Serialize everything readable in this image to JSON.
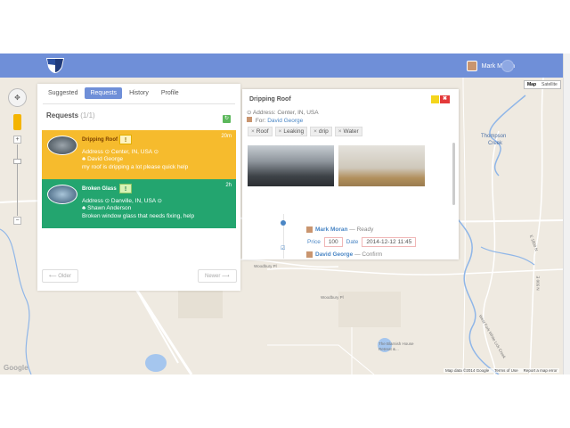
{
  "header": {
    "user_name": "Mark Moran"
  },
  "map": {
    "type_map": "Map",
    "type_satellite": "Satellite",
    "pan_glyph": "✥",
    "zoom_in": "+",
    "zoom_out": "−",
    "google": "Google",
    "attrib_data": "Map data ©2014 Google",
    "attrib_terms": "Terms of Use",
    "attrib_report": "Report a map error",
    "labels": {
      "thompson": "Thompson",
      "creek": "Creek",
      "woodbury": "Woodbury Pl",
      "woodbury2": "Woodbury Pl",
      "blarney": "The Blarnish House Retreat &...",
      "e1800": "E 1800 N",
      "n900": "N 500 E",
      "n500": "N 500 E",
      "wf": "West Fork White Lick Creek"
    }
  },
  "tabs": [
    "Suggested",
    "Requests",
    "History",
    "Profile"
  ],
  "requests": {
    "title": "Requests",
    "count": "(1/1)",
    "refresh_glyph": "↻",
    "items": [
      {
        "title": "Dripping Roof",
        "badge": "!",
        "time": "20m",
        "address": "Address ⊙ Center, IN, USA ⊙",
        "person": "♣ David George",
        "desc": "my roof is dripping a lot please quick help"
      },
      {
        "title": "Broken Glass",
        "badge": "!",
        "time": "2h",
        "address": "Address ⊙ Danville, IN, USA ⊙",
        "person": "♣ Shawn Anderson",
        "desc": "Broken window glass that needs fixing, help"
      }
    ],
    "older": "⟵ Older",
    "newer": "Newer ⟶"
  },
  "detail": {
    "title": "Dripping Roof",
    "close_glyph": "✖",
    "address": "⊙ Address: Center, IN, USA",
    "for_label": "For:",
    "for_name": "David George",
    "tags": [
      "Roof",
      "Leaking",
      "drip",
      "Water"
    ],
    "tag_remove": "×",
    "timeline": {
      "name1": "Mark Moran",
      "status1": "— Ready",
      "price_label": "Price",
      "price_value": "100",
      "date_label": "Date",
      "date_value": "2014-12-12 11:45",
      "name2": "David George",
      "status2": "— Confirm"
    }
  }
}
